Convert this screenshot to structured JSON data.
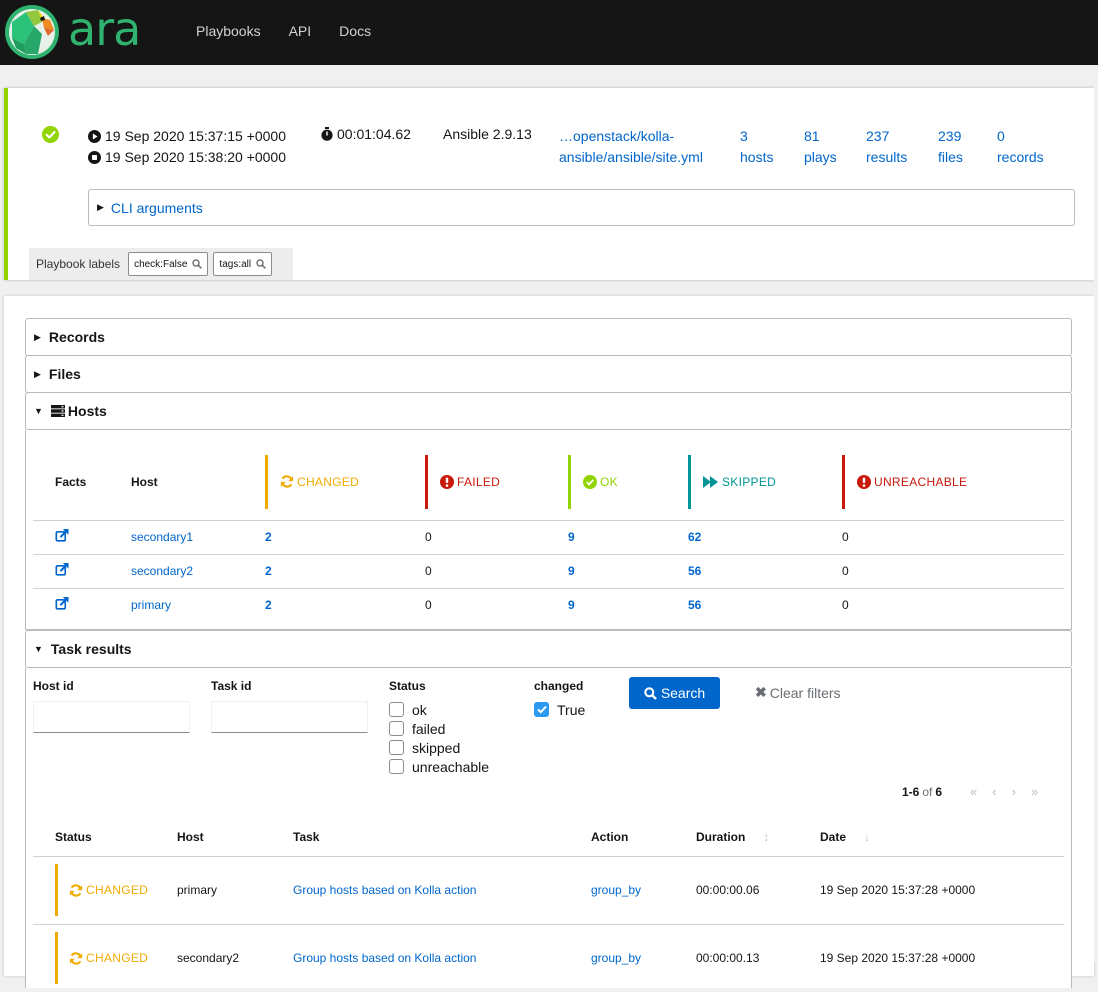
{
  "app": {
    "logo_text": "ara",
    "nav": [
      "Playbooks",
      "API",
      "Docs"
    ]
  },
  "playbook": {
    "status": "completed",
    "started": "19 Sep 2020 15:37:15 +0000",
    "ended": "19 Sep 2020 15:38:20 +0000",
    "duration": "00:01:04.62",
    "ansible_version": "Ansible 2.9.13",
    "path_line1": "…openstack/kolla-",
    "path_line2": "ansible/ansible/site.yml",
    "stats": [
      {
        "count": "3",
        "label": "hosts"
      },
      {
        "count": "81",
        "label": "plays"
      },
      {
        "count": "237",
        "label": "results"
      },
      {
        "count": "239",
        "label": "files"
      },
      {
        "count": "0",
        "label": "records"
      }
    ],
    "cli_arguments_label": "CLI arguments",
    "labels_title": "Playbook labels",
    "labels": [
      "check:False",
      "tags:all"
    ]
  },
  "sections": {
    "records": "Records",
    "files": "Files",
    "hosts": "Hosts",
    "task_results": "Task results"
  },
  "hosts_table": {
    "columns": {
      "facts": "Facts",
      "host": "Host",
      "changed": "CHANGED",
      "failed": "FAILED",
      "ok": "OK",
      "skipped": "SKIPPED",
      "unreachable": "UNREACHABLE"
    },
    "rows": [
      {
        "host": "secondary1",
        "changed": "2",
        "failed": "0",
        "ok": "9",
        "skipped": "62",
        "unreachable": "0"
      },
      {
        "host": "secondary2",
        "changed": "2",
        "failed": "0",
        "ok": "9",
        "skipped": "56",
        "unreachable": "0"
      },
      {
        "host": "primary",
        "changed": "2",
        "failed": "0",
        "ok": "9",
        "skipped": "56",
        "unreachable": "0"
      }
    ]
  },
  "filters": {
    "host_id_label": "Host id",
    "host_id_value": "",
    "task_id_label": "Task id",
    "task_id_value": "",
    "status_label": "Status",
    "status_options": [
      {
        "label": "ok",
        "checked": false
      },
      {
        "label": "failed",
        "checked": false
      },
      {
        "label": "skipped",
        "checked": false
      },
      {
        "label": "unreachable",
        "checked": false
      }
    ],
    "changed_label": "changed",
    "changed_option": {
      "label": "True",
      "checked": true
    },
    "search_label": "Search",
    "clear_label": "Clear filters"
  },
  "pagination": {
    "range": "1-6",
    "of": "of",
    "total": "6"
  },
  "results_table": {
    "columns": {
      "status": "Status",
      "host": "Host",
      "task": "Task",
      "action": "Action",
      "duration": "Duration",
      "date": "Date"
    },
    "rows": [
      {
        "status": "CHANGED",
        "host": "primary",
        "task": "Group hosts based on Kolla action",
        "action": "group_by",
        "duration": "00:00:00.06",
        "date": "19 Sep 2020 15:37:28 +0000"
      },
      {
        "status": "CHANGED",
        "host": "secondary2",
        "task": "Group hosts based on Kolla action",
        "action": "group_by",
        "duration": "00:00:00.13",
        "date": "19 Sep 2020 15:37:28 +0000"
      }
    ]
  },
  "colors": {
    "changed": "#f0ab00",
    "failed": "#c9190b",
    "ok": "#92d400",
    "skipped": "#009596",
    "unreachable": "#c9190b",
    "link": "#0066cc",
    "brand": "#2fb36e"
  }
}
